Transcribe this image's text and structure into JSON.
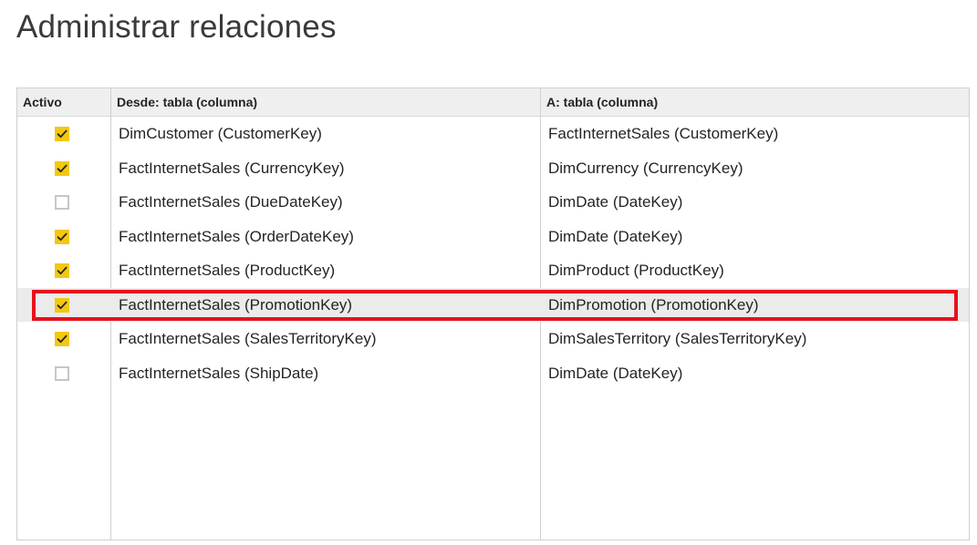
{
  "title": "Administrar relaciones",
  "columns": {
    "active": "Activo",
    "from": "Desde: tabla (columna)",
    "to": "A: tabla (columna)"
  },
  "rows": [
    {
      "active": true,
      "from": "DimCustomer (CustomerKey)",
      "to": "FactInternetSales (CustomerKey)"
    },
    {
      "active": true,
      "from": "FactInternetSales (CurrencyKey)",
      "to": "DimCurrency (CurrencyKey)"
    },
    {
      "active": false,
      "from": "FactInternetSales (DueDateKey)",
      "to": "DimDate (DateKey)"
    },
    {
      "active": true,
      "from": "FactInternetSales (OrderDateKey)",
      "to": "DimDate (DateKey)"
    },
    {
      "active": true,
      "from": "FactInternetSales (ProductKey)",
      "to": "DimProduct (ProductKey)"
    },
    {
      "active": true,
      "from": "FactInternetSales (PromotionKey)",
      "to": "DimPromotion (PromotionKey)",
      "selected": true
    },
    {
      "active": true,
      "from": "FactInternetSales (SalesTerritoryKey)",
      "to": "DimSalesTerritory (SalesTerritoryKey)"
    },
    {
      "active": false,
      "from": "FactInternetSales (ShipDate)",
      "to": "DimDate (DateKey)"
    }
  ],
  "colors": {
    "checkbox_checked": "#f2c811",
    "highlight_border": "#e8101d",
    "selected_row": "#ebebeb"
  }
}
